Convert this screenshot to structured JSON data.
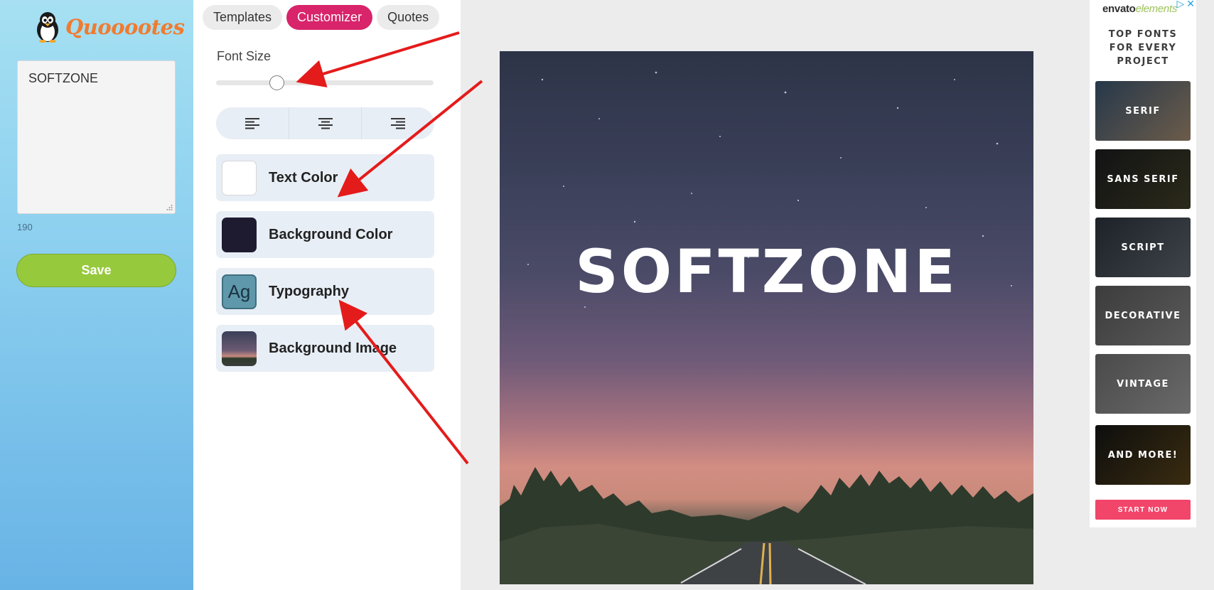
{
  "app": {
    "name": "Quooootes"
  },
  "editor": {
    "quote_text": "SOFTZONE",
    "char_count": "190",
    "save_label": "Save"
  },
  "tabs": [
    {
      "label": "Templates",
      "active": false
    },
    {
      "label": "Customizer",
      "active": true
    },
    {
      "label": "Quotes",
      "active": false
    }
  ],
  "customizer": {
    "font_size_label": "Font Size",
    "font_size_level": 0.28,
    "align_options": [
      "align-left",
      "align-center",
      "align-right"
    ],
    "options": [
      {
        "label": "Text Color",
        "swatch": "#ffffff"
      },
      {
        "label": "Background Color",
        "swatch": "#1e1b31"
      },
      {
        "label": "Typography",
        "preview_text": "Ag"
      },
      {
        "label": "Background Image"
      }
    ]
  },
  "canvas": {
    "text": "SOFTZONE",
    "text_color": "#ffffff"
  },
  "ad": {
    "brand_main": "envato",
    "brand_light": "elements",
    "headline": "TOP FONTS FOR EVERY PROJECT",
    "tiles": [
      {
        "label": "SERIF"
      },
      {
        "label": "SANS SERIF"
      },
      {
        "label": "SCRIPT"
      },
      {
        "label": "DECORATIVE"
      },
      {
        "label": "VINTAGE"
      },
      {
        "label": "AND MORE!"
      }
    ],
    "cta": "START NOW"
  },
  "colors": {
    "accent": "#d8246a",
    "save_button": "#97c93d",
    "cta": "#f2456a",
    "logo": "#f07b2f",
    "annotation_arrow": "#e41b1b"
  }
}
